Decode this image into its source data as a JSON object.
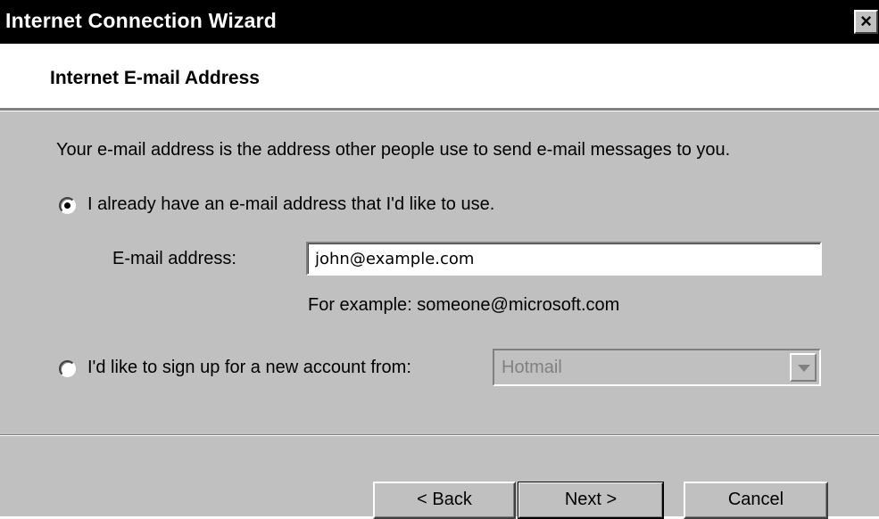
{
  "window": {
    "title": "Internet Connection Wizard",
    "close_glyph": "×"
  },
  "header": {
    "title": "Internet E-mail Address"
  },
  "body": {
    "intro": "Your e-mail address is the address other people use to send e-mail messages to you.",
    "option_existing": {
      "label": "I already have an e-mail address that I'd like to use.",
      "selected": true
    },
    "email_label": "E-mail address:",
    "email_value": "john@example.com",
    "example_text": "For example: someone@microsoft.com",
    "option_new": {
      "label": "I'd like to sign up for a new account from:",
      "selected": false
    },
    "provider_select": {
      "value": "Hotmail",
      "disabled": true
    }
  },
  "footer": {
    "back_label": "< Back",
    "next_label": "Next >",
    "cancel_label": "Cancel"
  },
  "colors": {
    "titlebar": "#000000",
    "dialog_face": "#c0c0c0",
    "header_bg": "#ffffff",
    "disabled_text": "#808080"
  }
}
